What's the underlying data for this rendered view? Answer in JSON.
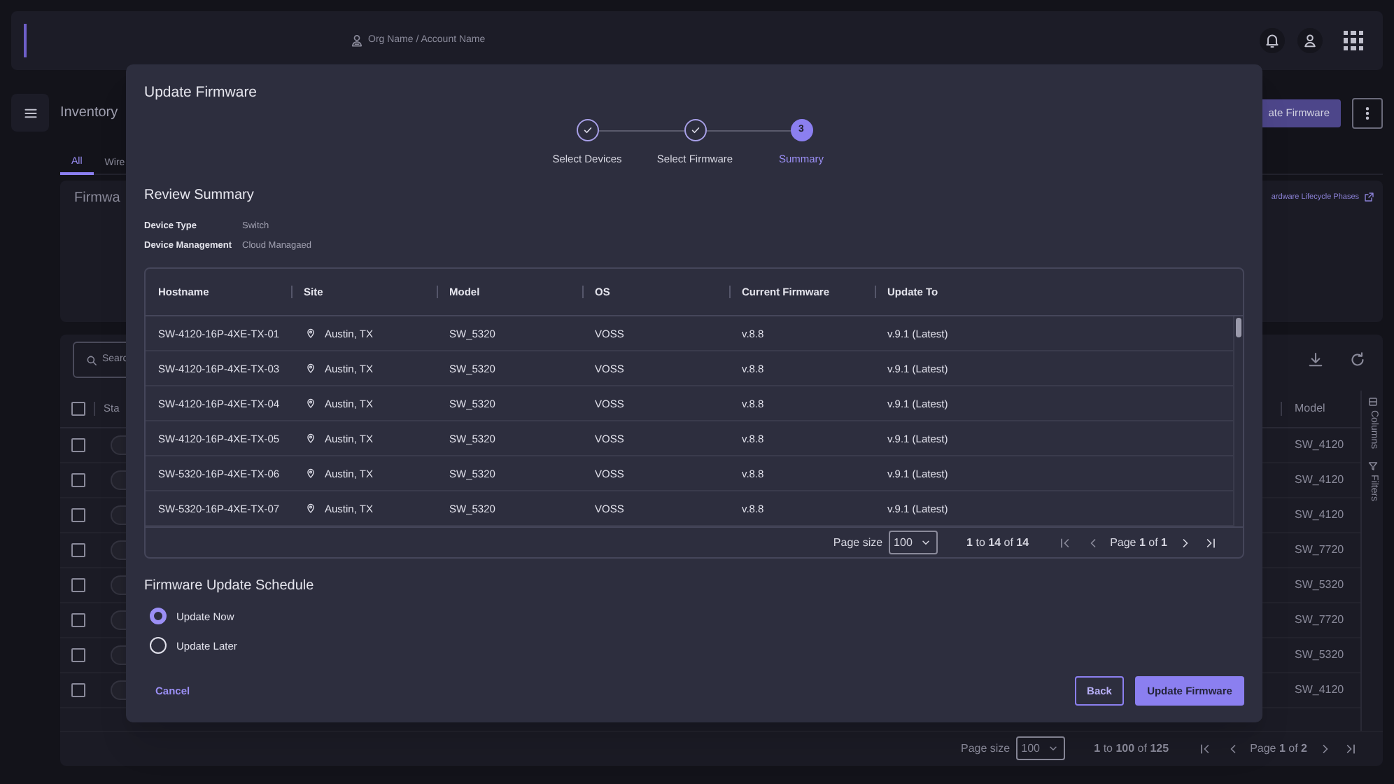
{
  "topbar": {
    "account": "Org Name / Account Name"
  },
  "page": {
    "title": "Inventory",
    "action_button": "ate Firmware",
    "tabs": [
      {
        "label": "All",
        "selected": true
      },
      {
        "label": "Wire",
        "selected": false
      }
    ],
    "firmware_card": {
      "title": "Firmwa",
      "link": "ardware Lifecycle Phases"
    },
    "devices_table": {
      "search_placeholder": "Searc",
      "select_all_checked": false,
      "columns": [
        "Sta",
        "Model"
      ],
      "rows": [
        {
          "checked": false,
          "model": "SW_4120"
        },
        {
          "checked": false,
          "model": "SW_4120"
        },
        {
          "checked": false,
          "model": "SW_4120"
        },
        {
          "checked": false,
          "model": "SW_7720"
        },
        {
          "checked": false,
          "model": "SW_5320"
        },
        {
          "checked": false,
          "model": "SW_7720"
        },
        {
          "checked": false,
          "model": "SW_5320"
        },
        {
          "checked": false,
          "model": "SW_4120"
        }
      ],
      "side_tabs": [
        "Columns",
        "Filters"
      ],
      "pagination": {
        "page_size_label": "Page size",
        "page_size": "100",
        "range": "**1** to **100** of **125**",
        "page": "Page **1** of **2**"
      }
    }
  },
  "dialog": {
    "title": "Update Firmware",
    "steps": [
      {
        "label": "Select Devices",
        "completed": true,
        "active": false
      },
      {
        "label": "Select Firmware",
        "completed": true,
        "active": false
      },
      {
        "label": "Summary",
        "completed": false,
        "active": true,
        "number": "3"
      }
    ],
    "review_title": "Review Summary",
    "details": [
      {
        "label": "Device Type",
        "value": "Switch"
      },
      {
        "label": "Device Management",
        "value": "Cloud Managaed"
      }
    ],
    "table": {
      "columns": [
        "Hostname",
        "Site",
        "Model",
        "OS",
        "Current Firmware",
        "Update To"
      ],
      "rows": [
        [
          "SW-4120-16P-4XE-TX-01",
          "Austin, TX",
          "SW_5320",
          "VOSS",
          "v.8.8",
          "v.9.1 (Latest)"
        ],
        [
          "SW-4120-16P-4XE-TX-03",
          "Austin, TX",
          "SW_5320",
          "VOSS",
          "v.8.8",
          "v.9.1 (Latest)"
        ],
        [
          "SW-4120-16P-4XE-TX-04",
          "Austin, TX",
          "SW_5320",
          "VOSS",
          "v.8.8",
          "v.9.1 (Latest)"
        ],
        [
          "SW-4120-16P-4XE-TX-05",
          "Austin, TX",
          "SW_5320",
          "VOSS",
          "v.8.8",
          "v.9.1 (Latest)"
        ],
        [
          "SW-5320-16P-4XE-TX-06",
          "Austin, TX",
          "SW_5320",
          "VOSS",
          "v.8.8",
          "v.9.1 (Latest)"
        ],
        [
          "SW-5320-16P-4XE-TX-07",
          "Austin, TX",
          "SW_5320",
          "VOSS",
          "v.8.8",
          "v.9.1 (Latest)"
        ]
      ],
      "pagination": {
        "page_size_label": "Page size",
        "page_size": "100",
        "range": "**1** to **14** of **14**",
        "page": "Page **1** of **1**"
      }
    },
    "schedule": {
      "title": "Firmware Update Schedule",
      "options": [
        {
          "label": "Update Now",
          "selected": true
        },
        {
          "label": "Update Later",
          "selected": false
        }
      ]
    },
    "buttons": {
      "cancel": "Cancel",
      "back": "Back",
      "submit": "Update Firmware"
    }
  }
}
